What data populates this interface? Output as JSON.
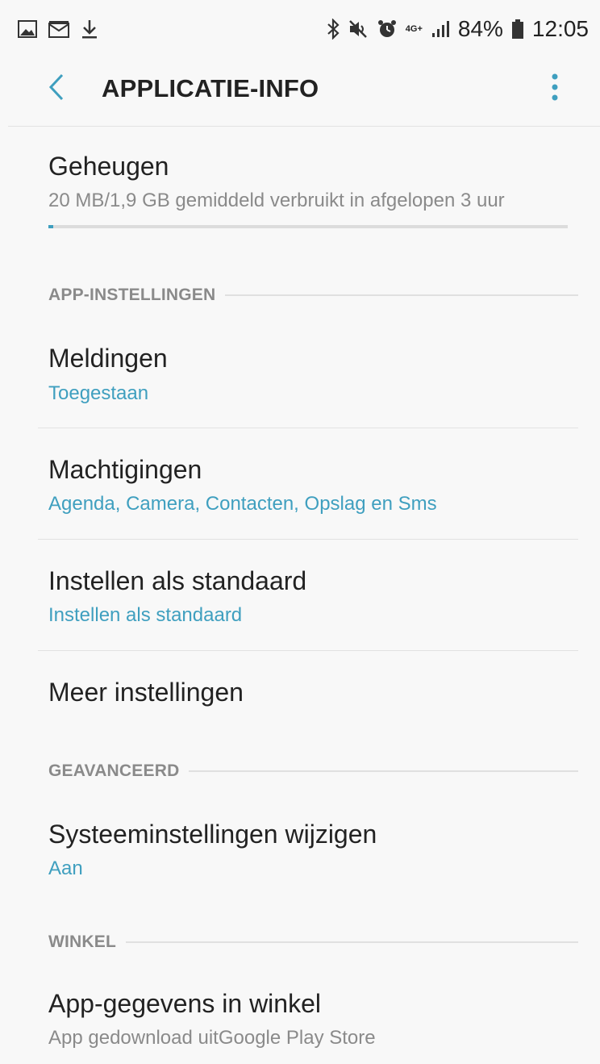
{
  "status_bar": {
    "left_icons": [
      "gallery-icon",
      "message-icon",
      "download-icon"
    ],
    "right_icons": [
      "bluetooth-icon",
      "mute-icon",
      "alarm-icon",
      "network-4g-icon",
      "signal-icon"
    ],
    "network_label": "4G+",
    "battery_percent": "84%",
    "time": "12:05"
  },
  "app_bar": {
    "back_icon": "chevron-left-icon",
    "title": "APPLICATIE-INFO",
    "more_icon": "more-vert-icon",
    "accent_color": "#3f9fbf"
  },
  "memory": {
    "title": "Geheugen",
    "subtitle": "20 MB/1,9 GB gemiddeld verbruikt in afgelopen 3 uur",
    "usage_fraction": 0.01
  },
  "sections": {
    "app_settings": "APP-INSTELLINGEN",
    "advanced": "GEAVANCEERD",
    "store": "WINKEL"
  },
  "items": {
    "notifications": {
      "title": "Meldingen",
      "subtitle": "Toegestaan"
    },
    "permissions": {
      "title": "Machtigingen",
      "subtitle": "Agenda, Camera, Contacten, Opslag en Sms"
    },
    "defaults": {
      "title": "Instellen als standaard",
      "subtitle": "Instellen als standaard"
    },
    "more_settings": {
      "title": "Meer instellingen"
    },
    "modify_system": {
      "title": "Systeeminstellingen wijzigen",
      "subtitle": "Aan"
    },
    "store_details": {
      "title": "App-gegevens in winkel",
      "subtitle": "App gedownload uitGoogle Play Store"
    }
  }
}
